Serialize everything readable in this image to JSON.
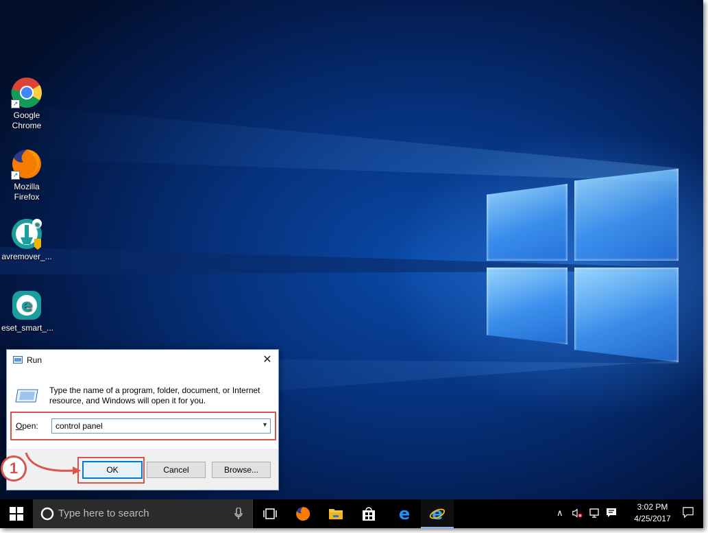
{
  "desktop": {
    "icons": [
      {
        "label": "Google\nChrome",
        "icon": "chrome-icon"
      },
      {
        "label": "Mozilla\nFirefox",
        "icon": "firefox-icon"
      },
      {
        "label": "avremover_...",
        "icon": "eset-avremover-icon"
      },
      {
        "label": "eset_smart_...",
        "icon": "eset-icon"
      }
    ]
  },
  "run_dialog": {
    "title": "Run",
    "description": "Type the name of a program, folder, document, or Internet resource, and Windows will open it for you.",
    "open_label": "Open:",
    "open_value": "control panel",
    "ok_label": "OK",
    "cancel_label": "Cancel",
    "browse_label": "Browse...",
    "close_glyph": "✕"
  },
  "annotation": {
    "step": "1",
    "color": "#d9534f"
  },
  "taskbar": {
    "search_placeholder": "Type here to search",
    "pinned": [
      "task-view-icon",
      "firefox-icon",
      "file-explorer-icon",
      "store-icon",
      "edge-icon",
      "internet-explorer-icon"
    ],
    "clock_time": "3:02 PM",
    "clock_date": "4/25/2017"
  },
  "colors": {
    "accent": "#0078d7",
    "desktop": "#06307a",
    "taskbar": "#000000"
  }
}
